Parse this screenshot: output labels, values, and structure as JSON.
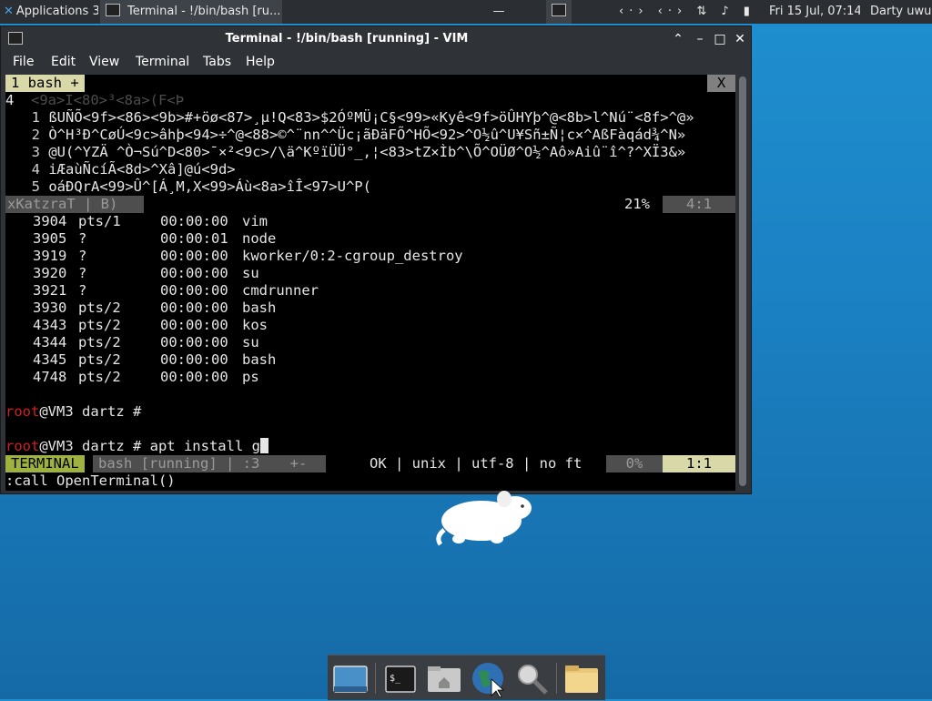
{
  "top_panel": {
    "apps_label": "Applications",
    "apps_suffix": "3",
    "task_label": "Terminal - !/bin/bash [ru...",
    "dash": "—",
    "tray_text": "‹·› ‹·› ⇅ ♪ ▮ ▲",
    "clock": "Fri 15 Jul, 07:14",
    "user": "Darty uwu"
  },
  "window": {
    "title": "Terminal - !/bin/bash [running] - VIM",
    "buttons": {
      "minimize": "⌃",
      "restore": "–",
      "maximize": "□",
      "close": "✕"
    },
    "menu": [
      "File",
      "Edit",
      "View",
      "Terminal",
      "Tabs",
      "Help"
    ]
  },
  "vim": {
    "tab_label": "1 bash +",
    "tab_close": "X",
    "buffer_lines": [
      {
        "num": "4",
        "text": "  <9a>I<80>³<8a>(F<Þ"
      },
      {
        "num": "1",
        "text": "ßUÑÕ<9f><86><9b>#+öø<87>¸µ!Q<83>$2ÓºMÜ¡C§<99>«Kyê<9f>öÛHYþ^@<8b>l^Nú¨<8f>^@»"
      },
      {
        "num": "2",
        "text": "Ò^H³Ð^CøÚ<9c>âhþ<94>÷^@<88>©^¨nn^^Üc¡ãÐäFÕ^HÕ<92>^O½û^U¥Sñ±Ñ¦c×^AßFàqád¾^N»"
      },
      {
        "num": "3",
        "text": "@U(^YZÄ ^Ò¬Sú^D<80>¯×²<9c>/\\ä^KºïÜÜ°_,¦<83>tZ×Ìb^\\Õ^OÜØ^O½^Aô»Aiû¨î^?^XÏ3&»"
      },
      {
        "num": "4",
        "text": "iÆaùÑcíÃ<8d>^Xâ]@ú<9d>"
      },
      {
        "num": "5",
        "text": "oáÐQrA<99>Û^[Á¸M,X<99>Áù<8a>îÎ<97>U^P("
      }
    ],
    "status_top_left": "xKatzraT | B)",
    "status_top_pct": "21%",
    "status_top_pos": "4:1",
    "processes": [
      {
        "pid": "3904",
        "tty": "pts/1",
        "time": "00:00:00",
        "cmd": "vim"
      },
      {
        "pid": "3905",
        "tty": "?",
        "time": "00:00:01",
        "cmd": "node"
      },
      {
        "pid": "3919",
        "tty": "?",
        "time": "00:00:00",
        "cmd": "kworker/0:2-cgroup_destroy"
      },
      {
        "pid": "3920",
        "tty": "?",
        "time": "00:00:00",
        "cmd": "su"
      },
      {
        "pid": "3921",
        "tty": "?",
        "time": "00:00:00",
        "cmd": "cmdrunner"
      },
      {
        "pid": "3930",
        "tty": "pts/2",
        "time": "00:00:00",
        "cmd": "bash"
      },
      {
        "pid": "4343",
        "tty": "pts/2",
        "time": "00:00:00",
        "cmd": "kos"
      },
      {
        "pid": "4344",
        "tty": "pts/2",
        "time": "00:00:00",
        "cmd": "su"
      },
      {
        "pid": "4345",
        "tty": "pts/2",
        "time": "00:00:00",
        "cmd": "bash"
      },
      {
        "pid": "4748",
        "tty": "pts/2",
        "time": "00:00:00",
        "cmd": "ps"
      }
    ],
    "prompt_user": "root",
    "prompt_rest": "@VM3 dartz #",
    "command_typed": " apt install g",
    "status_mode": "TERMINAL",
    "status_file": "bash [running] | :3",
    "status_file2": "+-",
    "status_enc": "OK | unix | utf-8 | no ft",
    "status_pct": "0%",
    "status_pos": "1:1",
    "cmdline": ":call OpenTerminal()"
  },
  "colors": {
    "accent_green": "#9fb23f",
    "tab_bg": "#d8d8a8",
    "prompt_red": "#d21f1f",
    "desktop": "#1b82c4"
  },
  "dock_icons": [
    "desktop-icon",
    "terminal-icon",
    "home-folder-icon",
    "web-browser-icon",
    "search-icon",
    "folder-icon"
  ]
}
